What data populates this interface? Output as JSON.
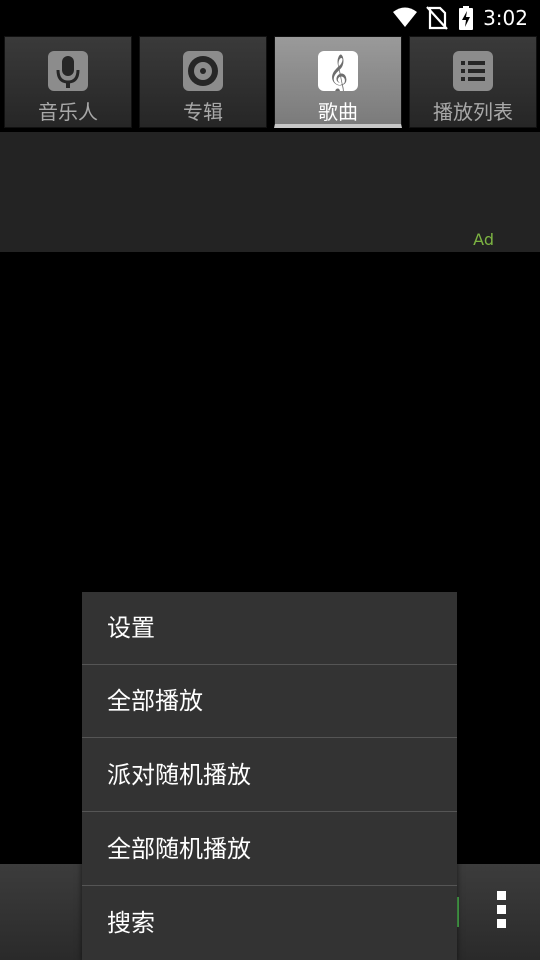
{
  "status_bar": {
    "time": "3:02",
    "icons": [
      "wifi-icon",
      "no-sim-icon",
      "battery-charging-icon"
    ]
  },
  "tabs": [
    {
      "label": "音乐人",
      "icon": "microphone-icon",
      "selected": false
    },
    {
      "label": "专辑",
      "icon": "disc-icon",
      "selected": false
    },
    {
      "label": "歌曲",
      "icon": "treble-clef-icon",
      "selected": true
    },
    {
      "label": "播放列表",
      "icon": "list-icon",
      "selected": false
    }
  ],
  "ad": {
    "label": "Ad",
    "color": "#7cb342"
  },
  "menu": {
    "items": [
      {
        "label": "设置"
      },
      {
        "label": "全部播放"
      },
      {
        "label": "派对随机播放"
      },
      {
        "label": "全部随机播放"
      },
      {
        "label": "搜索"
      }
    ]
  },
  "bottom_bar": {
    "overflow_icon": "more-vert-icon",
    "accent_color": "#4caf50"
  }
}
